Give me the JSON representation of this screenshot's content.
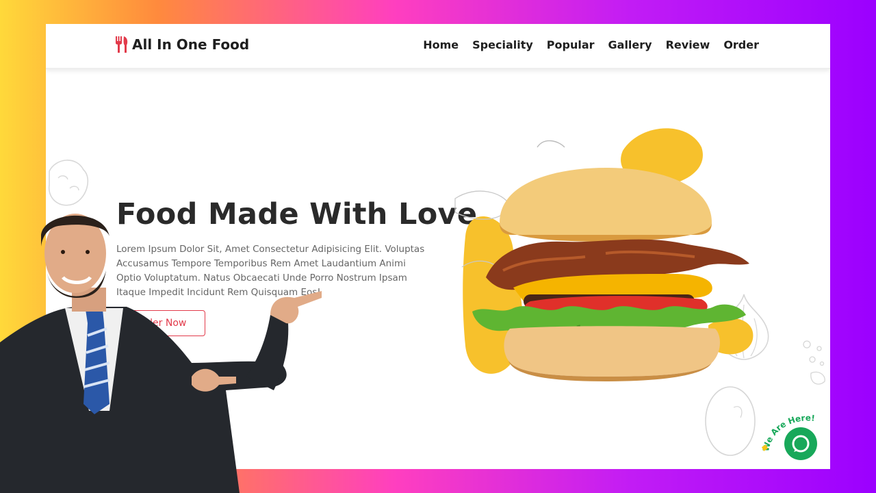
{
  "brand": {
    "name": "All In One Food",
    "icon": "fork-knife-icon",
    "accent_color": "#e23a4a"
  },
  "nav": {
    "links": [
      "Home",
      "Speciality",
      "Popular",
      "Gallery",
      "Review",
      "Order"
    ]
  },
  "hero": {
    "title": "Food Made With Love",
    "description": "Lorem Ipsum Dolor Sit, Amet Consectetur Adipisicing Elit. Voluptas Accusamus Tempore Temporibus Rem Amet Laudantium Animi Optio Voluptatum. Natus Obcaecati Unde Porro Nostrum Ipsam Itaque Impedit Incidunt Rem Quisquam Eos!",
    "button_label": "Order Now",
    "image": "burger-image"
  },
  "chat_widget": {
    "label": "We Are Here!",
    "icon": "chat-bubble-icon",
    "color": "#18a85a"
  },
  "overlay": {
    "image": "presenter-man-pointing"
  }
}
